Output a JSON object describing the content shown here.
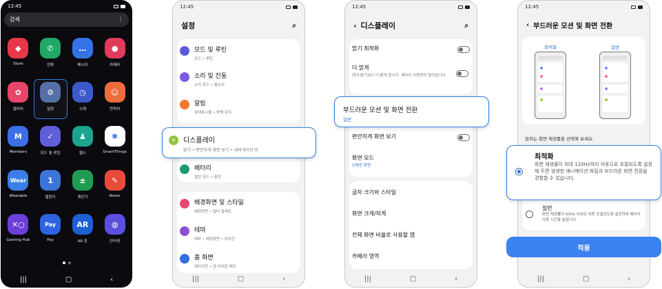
{
  "phone1": {
    "time": "12:45",
    "search_label": "검색",
    "apps": [
      {
        "label": "Store",
        "icon": "store-icon",
        "color": "#e8374a",
        "glyph": "◆"
      },
      {
        "label": "전화",
        "icon": "phone-icon",
        "color": "#1fa866",
        "glyph": "✆"
      },
      {
        "label": "메시지",
        "icon": "message-icon",
        "color": "#3572e8",
        "glyph": "…"
      },
      {
        "label": "카메라",
        "icon": "camera-icon",
        "color": "#e33a5c",
        "glyph": "●"
      },
      {
        "label": "갤러리",
        "icon": "gallery-icon",
        "color": "#e8456a",
        "glyph": "✿"
      },
      {
        "label": "설정",
        "icon": "settings-icon",
        "color": "#5570a6",
        "glyph": "⚙",
        "selected": true
      },
      {
        "label": "시계",
        "icon": "clock-icon",
        "color": "#3d59c9",
        "glyph": "◷"
      },
      {
        "label": "연락처",
        "icon": "contacts-icon",
        "color": "#ee6b3c",
        "glyph": "☺"
      },
      {
        "label": "Members",
        "icon": "members-icon",
        "color": "#3c6ee6",
        "glyph": "M"
      },
      {
        "label": "모드 및 루틴",
        "icon": "modes-routines-icon",
        "color": "#5f5fd9",
        "glyph": "✓"
      },
      {
        "label": "헬스",
        "icon": "health-icon",
        "color": "#1ba58d",
        "glyph": "♟"
      },
      {
        "label": "SmartThings",
        "icon": "smartthings-icon",
        "color": "#ffffff",
        "glyph": "✱"
      },
      {
        "label": "Wearable",
        "icon": "wearable-icon",
        "color": "#3b7ee8",
        "glyph": "Wear"
      },
      {
        "label": "캘린더",
        "icon": "calendar-icon",
        "color": "#3c74d9",
        "glyph": "1"
      },
      {
        "label": "계산기",
        "icon": "calculator-icon",
        "color": "#1e9d52",
        "glyph": "±"
      },
      {
        "label": "Notes",
        "icon": "notes-icon",
        "color": "#e84b3a",
        "glyph": "✎"
      },
      {
        "label": "Gaming Hub",
        "icon": "gaming-hub-icon",
        "color": "#6b3fd8",
        "glyph": "✕○"
      },
      {
        "label": "Pay",
        "icon": "pay-icon",
        "color": "#2f63e0",
        "glyph": "Pay"
      },
      {
        "label": "AR 존",
        "icon": "ar-zone-icon",
        "color": "#1e5ed6",
        "glyph": "AR"
      },
      {
        "label": "인터넷",
        "icon": "internet-icon",
        "color": "#5a4fe0",
        "glyph": "◍"
      }
    ]
  },
  "phone2": {
    "time": "12:45",
    "title": "설정",
    "items": [
      {
        "title": "모드 및 루틴",
        "sub": "모드 • 루틴",
        "color": "#5b5bd6",
        "icon": "modes-routines-icon"
      },
      {
        "title": "소리 및 진동",
        "sub": "소리 모드 • 벨소리",
        "color": "#7a5ae0",
        "icon": "sound-icon"
      },
      {
        "title": "알림",
        "sub": "상태표시줄 • 방해 금지",
        "color": "#ef7a2f",
        "icon": "notification-icon"
      },
      {
        "title": "디스플레이",
        "sub": "밝기 • 편안하게 화면 보기 • 내비게이션 바",
        "color": "#8ec63f",
        "icon": "display-icon"
      },
      {
        "title": "배터리",
        "sub": "절전 모드 • 충전",
        "color": "#1e9d6a",
        "icon": "battery-icon"
      },
      {
        "title": "배경화면 및 스타일",
        "sub": "배경화면 • 컬러 팔레트",
        "color": "#e8486f",
        "icon": "wallpaper-icon"
      },
      {
        "title": "테마",
        "sub": "테마 • 배경화면 • 아이콘",
        "color": "#8c4fd8",
        "icon": "theme-icon"
      },
      {
        "title": "홈 화면",
        "sub": "레이아웃 • 앱 아이콘 배지",
        "color": "#2f6fe0",
        "icon": "home-icon"
      }
    ]
  },
  "phone3": {
    "time": "12:45",
    "title": "디스플레이",
    "items": [
      {
        "title": "밝기 최적화",
        "sub": ""
      },
      {
        "title": "더 밝게",
        "sub": "최대 밝기보다 더 밝게 합니다. 배터리 사용량이 많아집니다."
      },
      {
        "title": "부드러운 모션 및 화면 전환",
        "sub": "일반"
      },
      {
        "title": "편안하게 화면 보기",
        "sub": ""
      },
      {
        "title": "화면 모드",
        "sub": "선명한 화면"
      },
      {
        "title": "글자 크기와 스타일",
        "sub": ""
      },
      {
        "title": "화면 크게/작게",
        "sub": ""
      },
      {
        "title": "전체 화면 비율로 사용할 앱",
        "sub": ""
      },
      {
        "title": "카메라 영역",
        "sub": ""
      }
    ]
  },
  "phone4": {
    "time": "12:45",
    "title": "부드러운 모션 및 화면 전환",
    "preview_left": "최적화",
    "preview_right": "일반",
    "prompt": "원하는 화면 재생률을 선택해 보세요.",
    "option1_title": "최적화",
    "option1_desc": "화면 재생률이 최대 120Hz까지 자동으로 조절되도록 설정해 두면 생생한 애니메이션 화질과 부드러운 화면 전환을 경험할 수 있습니다.",
    "option2_title": "일반",
    "option2_desc": "화면 재생률이 60Hz 이내로 자동 조절되도록 설정하여 배터리 사용 시간을 늘립니다.",
    "apply_label": "적용"
  },
  "colors": {
    "accent": "#2d7ee6",
    "apply": "#3b82f0"
  }
}
